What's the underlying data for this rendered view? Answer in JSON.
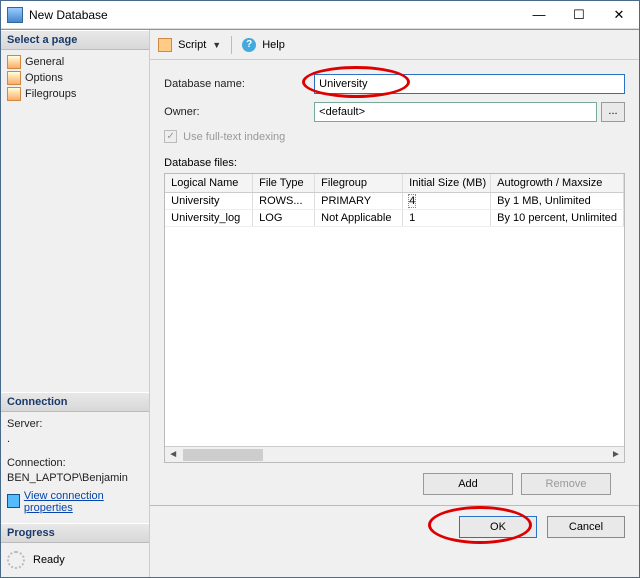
{
  "window": {
    "title": "New Database"
  },
  "sidebar": {
    "select_page_hdr": "Select a page",
    "pages": [
      {
        "label": "General"
      },
      {
        "label": "Options"
      },
      {
        "label": "Filegroups"
      }
    ],
    "connection_hdr": "Connection",
    "server_label": "Server:",
    "server_value": ".",
    "connection_label": "Connection:",
    "connection_value": "BEN_LAPTOP\\Benjamin",
    "view_props": "View connection properties",
    "progress_hdr": "Progress",
    "progress_status": "Ready"
  },
  "toolbar": {
    "script": "Script",
    "help": "Help"
  },
  "form": {
    "dbname_label": "Database name:",
    "dbname_value": "University",
    "owner_label": "Owner:",
    "owner_value": "<default>",
    "fulltext_label": "Use full-text indexing",
    "files_label": "Database files:"
  },
  "grid": {
    "headers": {
      "c1": "Logical Name",
      "c2": "File Type",
      "c3": "Filegroup",
      "c4": "Initial Size (MB)",
      "c5": "Autogrowth / Maxsize"
    },
    "rows": [
      {
        "c1": "University",
        "c2": "ROWS...",
        "c3": "PRIMARY",
        "c4": "4",
        "c5": "By 1 MB, Unlimited"
      },
      {
        "c1": "University_log",
        "c2": "LOG",
        "c3": "Not Applicable",
        "c4": "1",
        "c5": "By 10 percent, Unlimited"
      }
    ]
  },
  "buttons": {
    "add": "Add",
    "remove": "Remove",
    "ok": "OK",
    "cancel": "Cancel"
  }
}
